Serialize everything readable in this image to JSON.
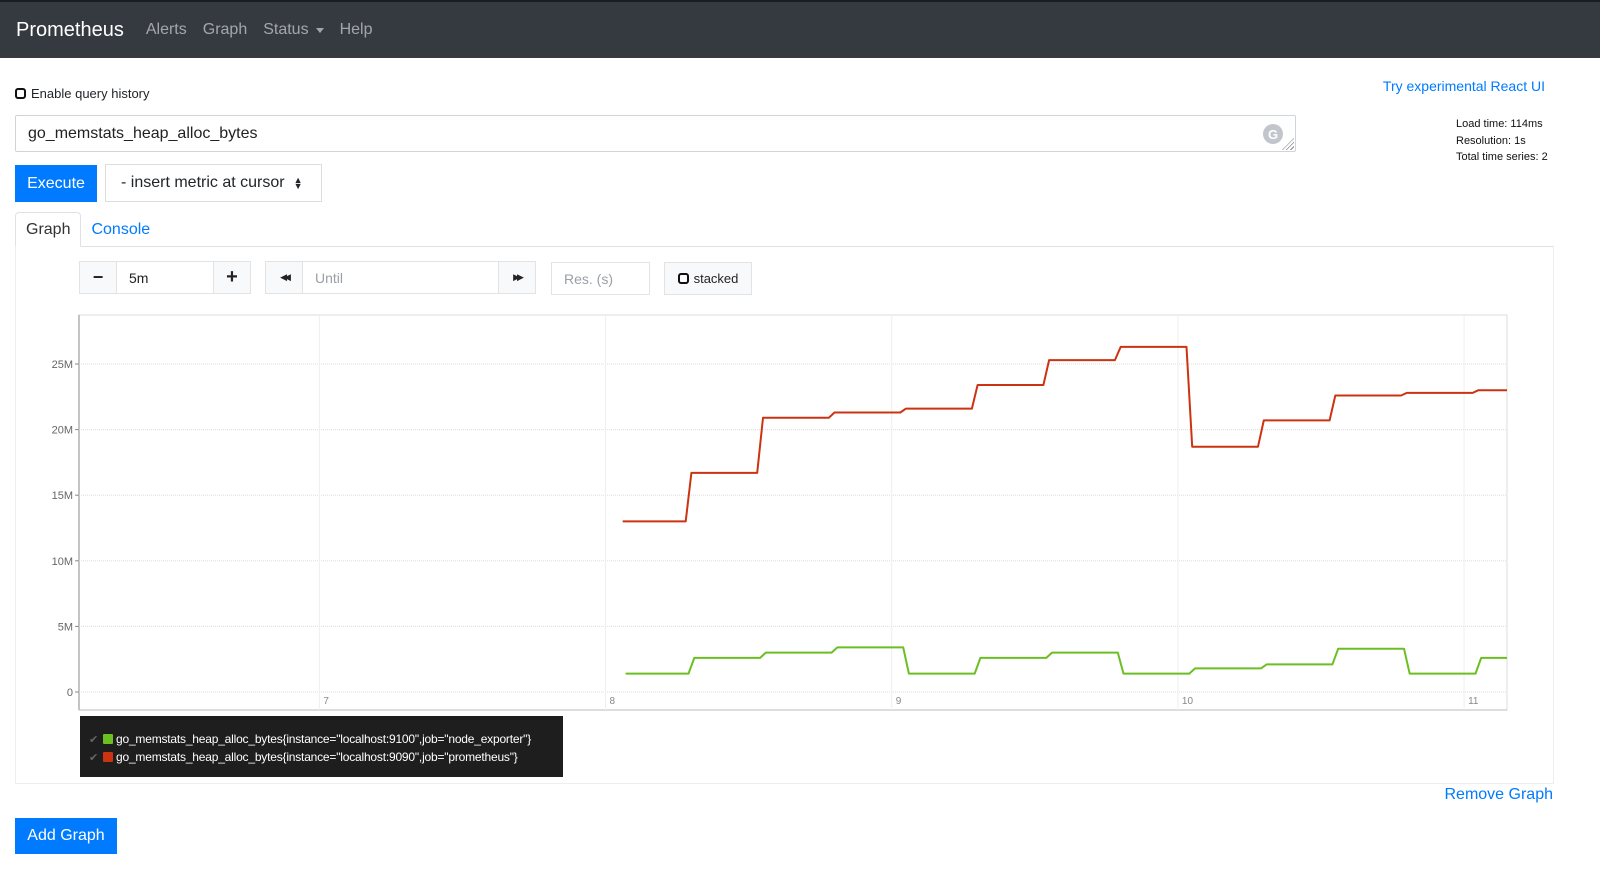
{
  "navbar": {
    "brand": "Prometheus",
    "links": [
      "Alerts",
      "Graph",
      "Status",
      "Help"
    ]
  },
  "query_history": {
    "label": "Enable query history",
    "checked": false
  },
  "react_link": "Try experimental React UI",
  "query": {
    "value": "go_memstats_heap_alloc_bytes"
  },
  "stats": {
    "load_time": "Load time: 114ms",
    "resolution": "Resolution: 1s",
    "total_series": "Total time series: 2"
  },
  "execute_label": "Execute",
  "metric_select": "- insert metric at cursor",
  "tabs": [
    {
      "label": "Graph",
      "active": true
    },
    {
      "label": "Console",
      "active": false
    }
  ],
  "controls": {
    "minus": "−",
    "range": "5m",
    "plus": "+",
    "back": "◀◀",
    "until_placeholder": "Until",
    "forward": "▶▶",
    "res_placeholder": "Res. (s)",
    "stacked_label": "stacked"
  },
  "chart_data": {
    "type": "line",
    "title": "",
    "xlabel": "",
    "ylabel": "",
    "xlim": [
      6.16,
      11.15
    ],
    "ylim": [
      0,
      28.7
    ],
    "y_unit": "M",
    "y_ticks": [
      0,
      5,
      10,
      15,
      20,
      25
    ],
    "y_tick_labels": [
      "0",
      "5M",
      "10M",
      "15M",
      "20M",
      "25M"
    ],
    "x_ticks": [
      7,
      8,
      9,
      10,
      11
    ],
    "x_tick_labels": [
      "7",
      "8",
      "9",
      "10",
      "11"
    ],
    "grid": true,
    "series": [
      {
        "name": "go_memstats_heap_alloc_bytes{instance=\"localhost:9100\",job=\"node_exporter\"}",
        "color": "#6bbf23",
        "points": [
          [
            8.07,
            1.4
          ],
          [
            8.29,
            1.4
          ],
          [
            8.31,
            2.6
          ],
          [
            8.54,
            2.6
          ],
          [
            8.56,
            3.0
          ],
          [
            8.79,
            3.0
          ],
          [
            8.81,
            3.4
          ],
          [
            9.04,
            3.4
          ],
          [
            9.06,
            1.4
          ],
          [
            9.29,
            1.4
          ],
          [
            9.31,
            2.6
          ],
          [
            9.54,
            2.6
          ],
          [
            9.56,
            3.0
          ],
          [
            9.79,
            3.0
          ],
          [
            9.81,
            1.4
          ],
          [
            10.04,
            1.4
          ],
          [
            10.06,
            1.8
          ],
          [
            10.29,
            1.8
          ],
          [
            10.31,
            2.1
          ],
          [
            10.54,
            2.1
          ],
          [
            10.56,
            3.3
          ],
          [
            10.79,
            3.3
          ],
          [
            10.81,
            1.4
          ],
          [
            11.04,
            1.4
          ],
          [
            11.06,
            2.6
          ],
          [
            11.15,
            2.6
          ]
        ]
      },
      {
        "name": "go_memstats_heap_alloc_bytes{instance=\"localhost:9090\",job=\"prometheus\"}",
        "color": "#cc3311",
        "points": [
          [
            8.06,
            13.0
          ],
          [
            8.28,
            13.0
          ],
          [
            8.3,
            16.7
          ],
          [
            8.53,
            16.7
          ],
          [
            8.55,
            20.9
          ],
          [
            8.78,
            20.9
          ],
          [
            8.8,
            21.3
          ],
          [
            9.03,
            21.3
          ],
          [
            9.05,
            21.6
          ],
          [
            9.28,
            21.6
          ],
          [
            9.3,
            23.4
          ],
          [
            9.53,
            23.4
          ],
          [
            9.55,
            25.3
          ],
          [
            9.78,
            25.3
          ],
          [
            9.8,
            26.3
          ],
          [
            10.03,
            26.3
          ],
          [
            10.05,
            18.7
          ],
          [
            10.28,
            18.7
          ],
          [
            10.3,
            20.7
          ],
          [
            10.53,
            20.7
          ],
          [
            10.55,
            22.6
          ],
          [
            10.78,
            22.6
          ],
          [
            10.8,
            22.8
          ],
          [
            11.03,
            22.8
          ],
          [
            11.05,
            23.0
          ],
          [
            11.15,
            23.0
          ]
        ]
      }
    ],
    "legend_position": "bottom-left"
  },
  "legend": [
    {
      "label": "go_memstats_heap_alloc_bytes{instance=\"localhost:9100\",job=\"node_exporter\"}",
      "color": "#6bbf23"
    },
    {
      "label": "go_memstats_heap_alloc_bytes{instance=\"localhost:9090\",job=\"prometheus\"}",
      "color": "#cc3311"
    }
  ],
  "remove_graph": "Remove Graph",
  "add_graph": "Add Graph"
}
